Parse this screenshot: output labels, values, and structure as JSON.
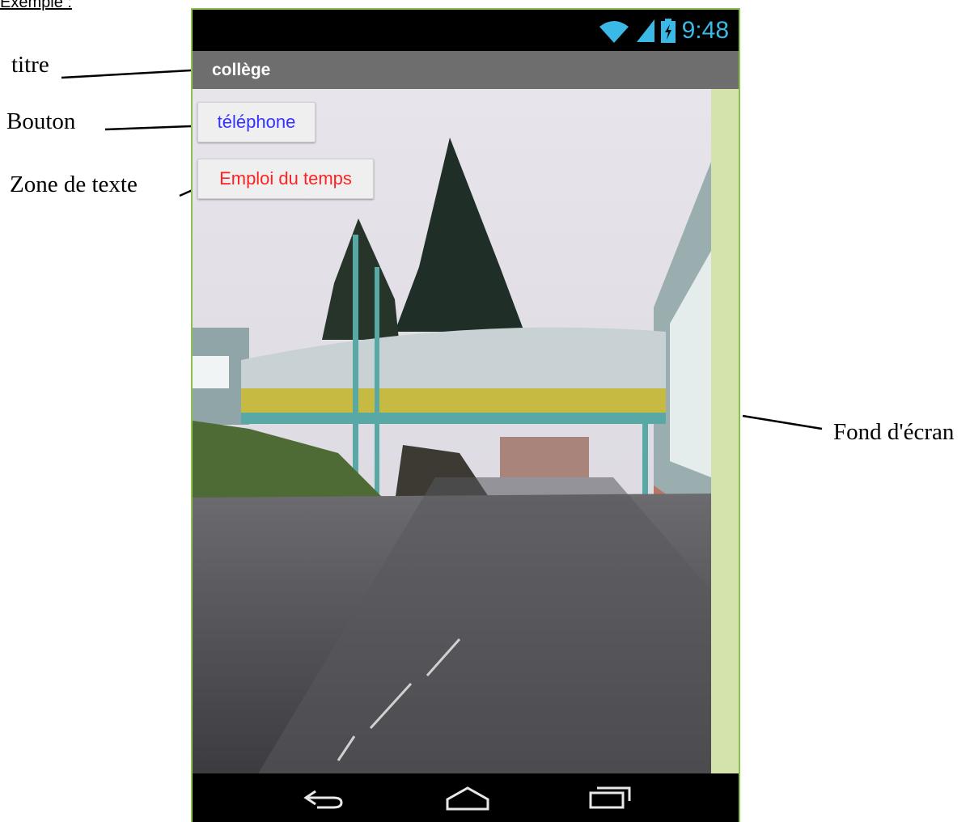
{
  "heading": "Exemple :",
  "annotations": {
    "titre": "titre",
    "bouton": "Bouton",
    "zone_texte": "Zone de texte",
    "fond_ecran": "Fond d'écran"
  },
  "phone": {
    "status_bar": {
      "time": "9:48",
      "icons": [
        "wifi-icon",
        "signal-icon",
        "battery-charging-icon"
      ],
      "accent": "#3ab9e6"
    },
    "title_bar": {
      "title": "collège",
      "color": "#6e6e6e"
    },
    "buttons": [
      {
        "label": "téléphone",
        "text_color": "#3333ff"
      },
      {
        "label": "Emploi du temps",
        "text_color": "#ff2222"
      }
    ],
    "background_image": "photo of school courtyard with covered footbridge, trees and buildings",
    "screen_background_color": "#d3e3ab",
    "nav_bar": {
      "icons": [
        "back-icon",
        "home-icon",
        "recent-apps-icon"
      ]
    }
  }
}
